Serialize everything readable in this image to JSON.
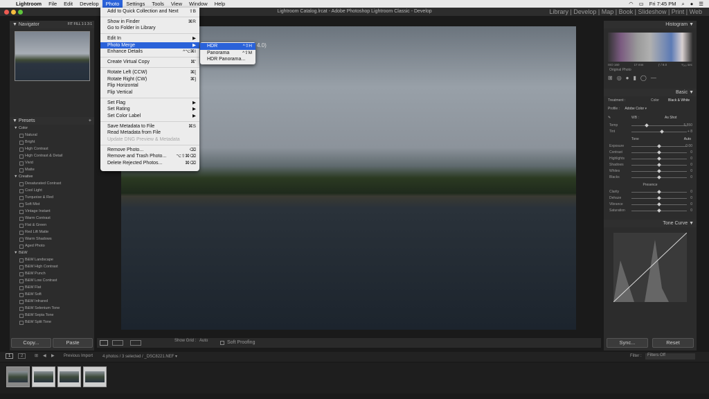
{
  "menubar": {
    "app": "Lightroom",
    "items": [
      "File",
      "Edit",
      "Develop",
      "Photo",
      "Settings",
      "Tools",
      "View",
      "Window",
      "Help"
    ],
    "active": "Photo",
    "clock": "Fri 7:45 PM"
  },
  "window": {
    "title": "Lightroom Catalog.lrcat - Adobe Photoshop Lightroom Classic - Develop",
    "modules": "Library  |  Develop  |  Map  |  Book  |  Slideshow  |  Print  |  Web"
  },
  "photo_menu": {
    "items": [
      {
        "label": "Add to Quick Collection and Next",
        "shortcut": "⇧B"
      },
      {
        "sep": true
      },
      {
        "label": "Show in Finder",
        "shortcut": "⌘R"
      },
      {
        "label": "Go to Folder in Library",
        "shortcut": ""
      },
      {
        "sep": true
      },
      {
        "label": "Edit In",
        "shortcut": "▶"
      },
      {
        "label": "Photo Merge",
        "shortcut": "▶",
        "highlight": true
      },
      {
        "label": "Enhance Details",
        "shortcut": "^⌥⌘I"
      },
      {
        "sep": true
      },
      {
        "label": "Create Virtual Copy",
        "shortcut": "⌘'"
      },
      {
        "sep": true
      },
      {
        "label": "Rotate Left (CCW)",
        "shortcut": "⌘["
      },
      {
        "label": "Rotate Right (CW)",
        "shortcut": "⌘]"
      },
      {
        "label": "Flip Horizontal",
        "shortcut": ""
      },
      {
        "label": "Flip Vertical",
        "shortcut": ""
      },
      {
        "sep": true
      },
      {
        "label": "Set Flag",
        "shortcut": "▶"
      },
      {
        "label": "Set Rating",
        "shortcut": "▶"
      },
      {
        "label": "Set Color Label",
        "shortcut": "▶"
      },
      {
        "sep": true
      },
      {
        "label": "Save Metadata to File",
        "shortcut": "⌘S"
      },
      {
        "label": "Read Metadata from File",
        "shortcut": ""
      },
      {
        "label": "Update DNG Preview & Metadata",
        "shortcut": "",
        "disabled": true
      },
      {
        "sep": true
      },
      {
        "label": "Remove Photo...",
        "shortcut": "⌫"
      },
      {
        "label": "Remove and Trash Photo...",
        "shortcut": "⌥⇧⌘⌫"
      },
      {
        "label": "Delete Rejected Photos...",
        "shortcut": "⌘⌫"
      }
    ]
  },
  "submenu": {
    "items": [
      {
        "label": "HDR",
        "shortcut": "^⇧H",
        "highlight": true
      },
      {
        "label": "Panorama",
        "shortcut": "^⇧M"
      },
      {
        "label": "HDR Panorama...",
        "shortcut": ""
      }
    ]
  },
  "left_panel": {
    "navigator": "Navigator",
    "nav_zoom": "FIT  FILL  1:1  3:1",
    "presets": "Presets",
    "groups": [
      {
        "name": "Color",
        "items": [
          "Natural",
          "Bright",
          "High Contrast",
          "High Contrast & Detail",
          "Vivid",
          "Matte"
        ]
      },
      {
        "name": "Creative",
        "items": [
          "Desaturated Contrast",
          "Cool Light",
          "Turquoise & Red",
          "Soft Mist",
          "Vintage Instant",
          "Warm Contrast",
          "Flat & Green",
          "Red Lift Matte",
          "Warm Shadows",
          "Aged Photo"
        ]
      },
      {
        "name": "B&W",
        "items": [
          "B&W Landscape",
          "B&W High Contrast",
          "B&W Punch",
          "B&W Low Contrast",
          "B&W Flat",
          "B&W Soft",
          "B&W Infrared",
          "B&W Selenium Tone",
          "B&W Sepia Tone",
          "B&W Split Tone"
        ]
      }
    ],
    "copy": "Copy...",
    "paste": "Paste"
  },
  "toolbar": {
    "show_grid": "Show Grid :",
    "auto": "Auto",
    "soft_proofing": "Soft Proofing"
  },
  "right_panel": {
    "histogram": "Histogram",
    "exif": [
      "ISO 160",
      "17 mm",
      "ƒ / 8.0",
      "¹⁄₁₆₀ sec"
    ],
    "original_photo": "Original Photo",
    "basic": "Basic",
    "treatment": "Treatment :",
    "color": "Color",
    "bw": "Black & White",
    "profile": "Profile :",
    "profile_value": "Adobe Color",
    "wb": "WB :",
    "wb_value": "As Shot",
    "temp": {
      "label": "Temp",
      "value": "5,550"
    },
    "tint": {
      "label": "Tint",
      "value": "+ 8"
    },
    "tone": "Tone",
    "tone_auto": "Auto",
    "sliders": [
      {
        "label": "Exposure",
        "value": "0.00"
      },
      {
        "label": "Contrast",
        "value": "0"
      },
      {
        "label": "Highlights",
        "value": "0"
      },
      {
        "label": "Shadows",
        "value": "0"
      },
      {
        "label": "Whites",
        "value": "0"
      },
      {
        "label": "Blacks",
        "value": "0"
      }
    ],
    "presence": "Presence",
    "presence_sliders": [
      {
        "label": "Clarity",
        "value": "0"
      },
      {
        "label": "Dehaze",
        "value": "0"
      },
      {
        "label": "Vibrance",
        "value": "0"
      },
      {
        "label": "Saturation",
        "value": "0"
      }
    ],
    "tone_curve": "Tone Curve",
    "sync": "Sync...",
    "reset": "Reset"
  },
  "filmstrip": {
    "page1": "1",
    "page2": "2",
    "source": "Previous Import",
    "count": "4 photos / 3 selected / _DSC8221.NEF ▾",
    "filter": "Filter :",
    "filter_value": "Filters Off"
  },
  "colors": {
    "accent": "#2a62d9"
  }
}
